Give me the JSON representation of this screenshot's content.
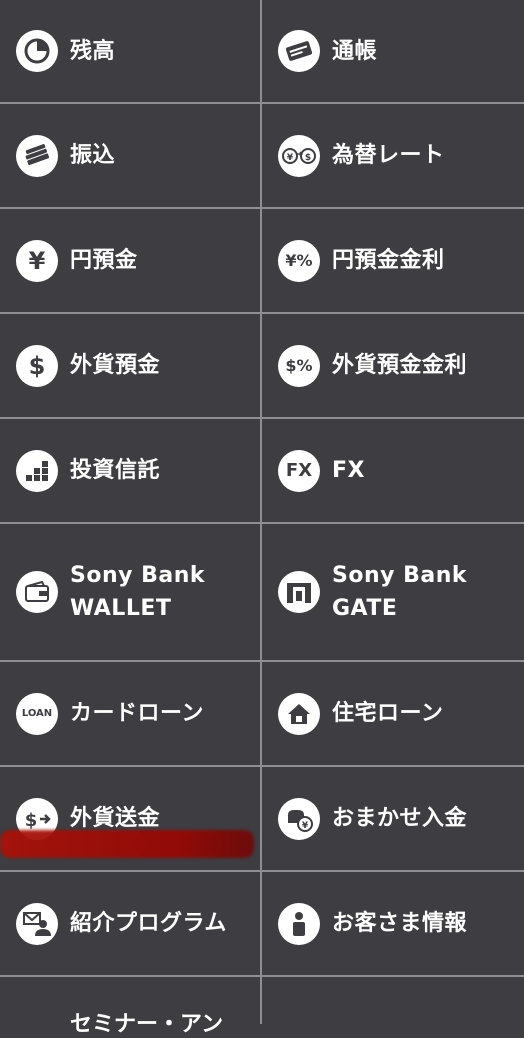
{
  "menu": [
    {
      "label": "残高",
      "icon": "pie-chart-icon"
    },
    {
      "label": "通帳",
      "icon": "passbook-icon"
    },
    {
      "label": "振込",
      "icon": "money-stack-icon"
    },
    {
      "label": "為替レート",
      "icon": "yen-dollar-exchange-icon"
    },
    {
      "label": "円預金",
      "icon": "yen-icon"
    },
    {
      "label": "円預金金利",
      "icon": "yen-percent-icon"
    },
    {
      "label": "外貨預金",
      "icon": "dollar-icon"
    },
    {
      "label": "外貨預金金利",
      "icon": "dollar-percent-icon"
    },
    {
      "label": "投資信託",
      "icon": "bar-steps-icon"
    },
    {
      "label": "FX",
      "icon": "fx-icon"
    },
    {
      "label": "Sony Bank WALLET",
      "icon": "wallet-icon"
    },
    {
      "label": "Sony Bank GATE",
      "icon": "gate-icon"
    },
    {
      "label": "カードローン",
      "icon": "loan-icon"
    },
    {
      "label": "住宅ローン",
      "icon": "house-icon"
    },
    {
      "label": "外貨送金",
      "icon": "dollar-send-icon"
    },
    {
      "label": "おまかせ入金",
      "icon": "auto-deposit-icon"
    },
    {
      "label": "紹介プログラム",
      "icon": "referral-icon"
    },
    {
      "label": "お客さま情報",
      "icon": "person-icon"
    }
  ],
  "partial_label": "セミナー・アン",
  "icon_text": {
    "loan": "LOAN",
    "fx": "FX",
    "yen": "¥",
    "yen_pct": "¥%",
    "dollar": "$",
    "dollar_pct": "$%"
  },
  "colors": {
    "cell_bg": "#3d3d42",
    "divider": "#8e8e93",
    "text": "#ffffff",
    "redaction": "#a8120a"
  }
}
